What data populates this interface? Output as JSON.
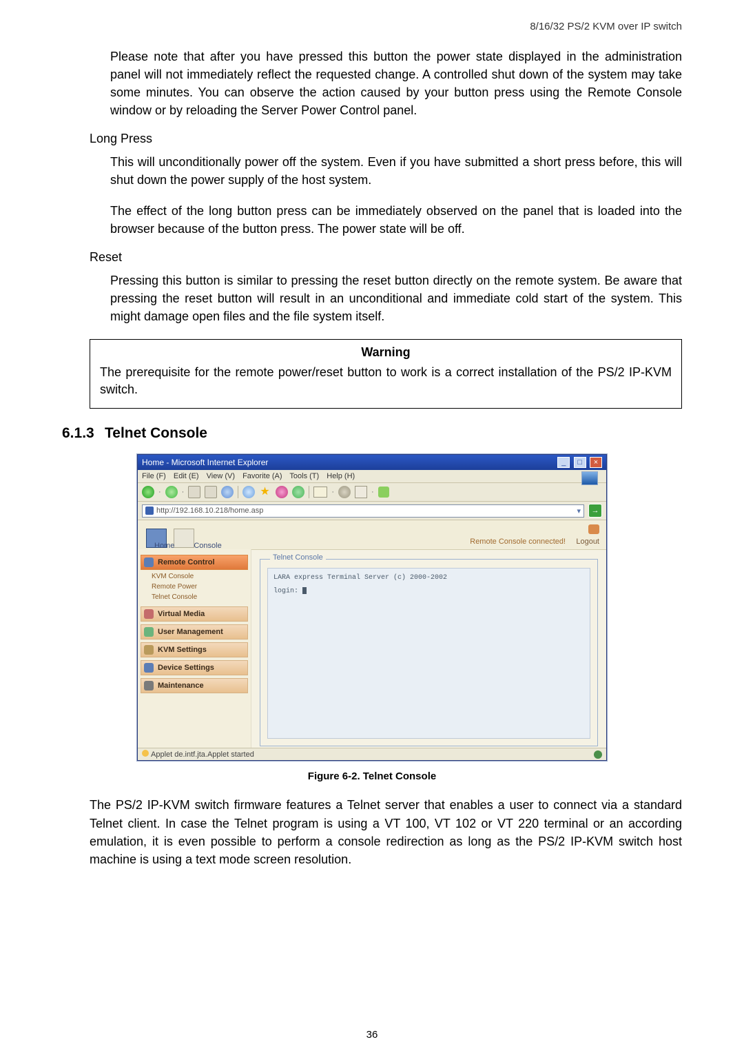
{
  "header_text": "8/16/32 PS/2 KVM over IP switch",
  "para_note": "Please note that after you have pressed this button the power state displayed in the administration panel will not immediately reflect the requested change. A controlled shut down of the system may take some minutes. You can observe the action caused by your button press using the Remote Console window or by reloading the Server Power Control panel.",
  "longpress_heading": "Long Press",
  "longpress_p1": "This will unconditionally power off the system. Even if you have submitted a short press before, this will shut down the power supply of the host system.",
  "longpress_p2": "The effect of the long button press can be immediately observed on the panel that is loaded into the browser because of the button press. The power state will be off.",
  "reset_heading": "Reset",
  "reset_p1": "Pressing this button is similar to pressing the reset button directly on the remote system. Be aware that pressing the reset button will result in an unconditional and immediate cold start of the system. This might damage open files and the file system itself.",
  "warning_title": "Warning",
  "warning_body": "The prerequisite for the remote power/reset button to work is a correct installation of the PS/2 IP-KVM switch.",
  "section_num": "6.1.3",
  "section_title": "Telnet Console",
  "ie": {
    "title": "Home - Microsoft Internet Explorer",
    "menu": [
      "File (F)",
      "Edit (E)",
      "View (V)",
      "Favorite (A)",
      "Tools (T)",
      "Help (H)"
    ],
    "address": "http://192.168.10.218/home.asp",
    "tabs": {
      "home": "Home",
      "console": "Console"
    },
    "status_right_line1": "Remote Console connected!",
    "status_right_line2": "Logout",
    "sidebar": {
      "remote_control": "Remote Control",
      "sub": [
        "KVM Console",
        "Remote Power",
        "Telnet Console"
      ],
      "items": [
        "Virtual Media",
        "User Management",
        "KVM Settings",
        "Device Settings",
        "Maintenance"
      ]
    },
    "fieldset_title": "Telnet Console",
    "terminal_line": "LARA express Terminal Server (c) 2000-2002",
    "terminal_prompt": "login:",
    "status_bar": "Applet de.intf.jta.Applet started"
  },
  "figure_caption": "Figure 6-2. Telnet Console",
  "bottom_para": "The PS/2 IP-KVM switch firmware features a Telnet server that enables a user to connect via a standard Telnet client. In case the Telnet program is using a VT 100, VT 102 or VT 220 terminal or an according emulation, it is even possible to perform a console redirection as long as the PS/2 IP-KVM switch host machine is using a text mode screen resolution.",
  "page_number": "36"
}
